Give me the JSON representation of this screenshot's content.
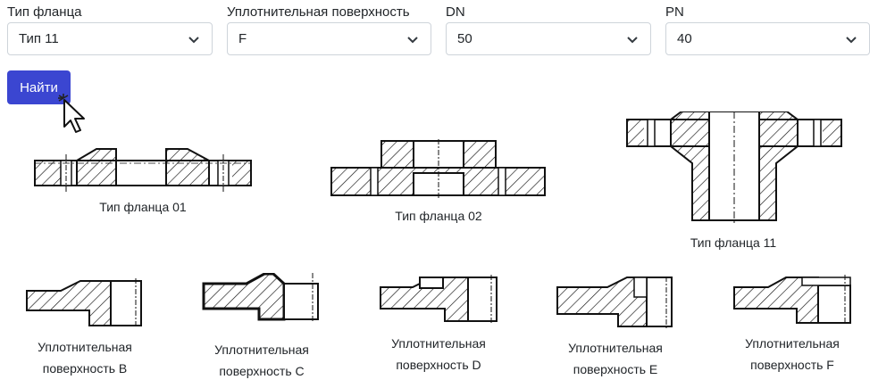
{
  "filters": [
    {
      "label": "Тип фланца",
      "value": "Тип 11"
    },
    {
      "label": "Уплотнительная поверхность",
      "value": "F"
    },
    {
      "label": "DN",
      "value": "50"
    },
    {
      "label": "PN",
      "value": "40"
    }
  ],
  "search_button": "Найти",
  "flange_types": [
    {
      "caption": "Тип фланца 01",
      "icon": "flange-type-01-drawing"
    },
    {
      "caption": "Тип фланца 02",
      "icon": "flange-type-02-drawing"
    },
    {
      "caption": "Тип фланца 11",
      "icon": "flange-type-11-drawing"
    }
  ],
  "surfaces": [
    {
      "line1": "Уплотнительная",
      "line2": "поверхность B"
    },
    {
      "line1": "Уплотнительная",
      "line2": "поверхность C"
    },
    {
      "line1": "Уплотнительная",
      "line2": "поверхность D"
    },
    {
      "line1": "Уплотнительная",
      "line2": "поверхность E"
    },
    {
      "line1": "Уплотнительная",
      "line2": "поверхность F"
    }
  ],
  "colors": {
    "button": "#3b46d1",
    "border": "#ced4da"
  }
}
